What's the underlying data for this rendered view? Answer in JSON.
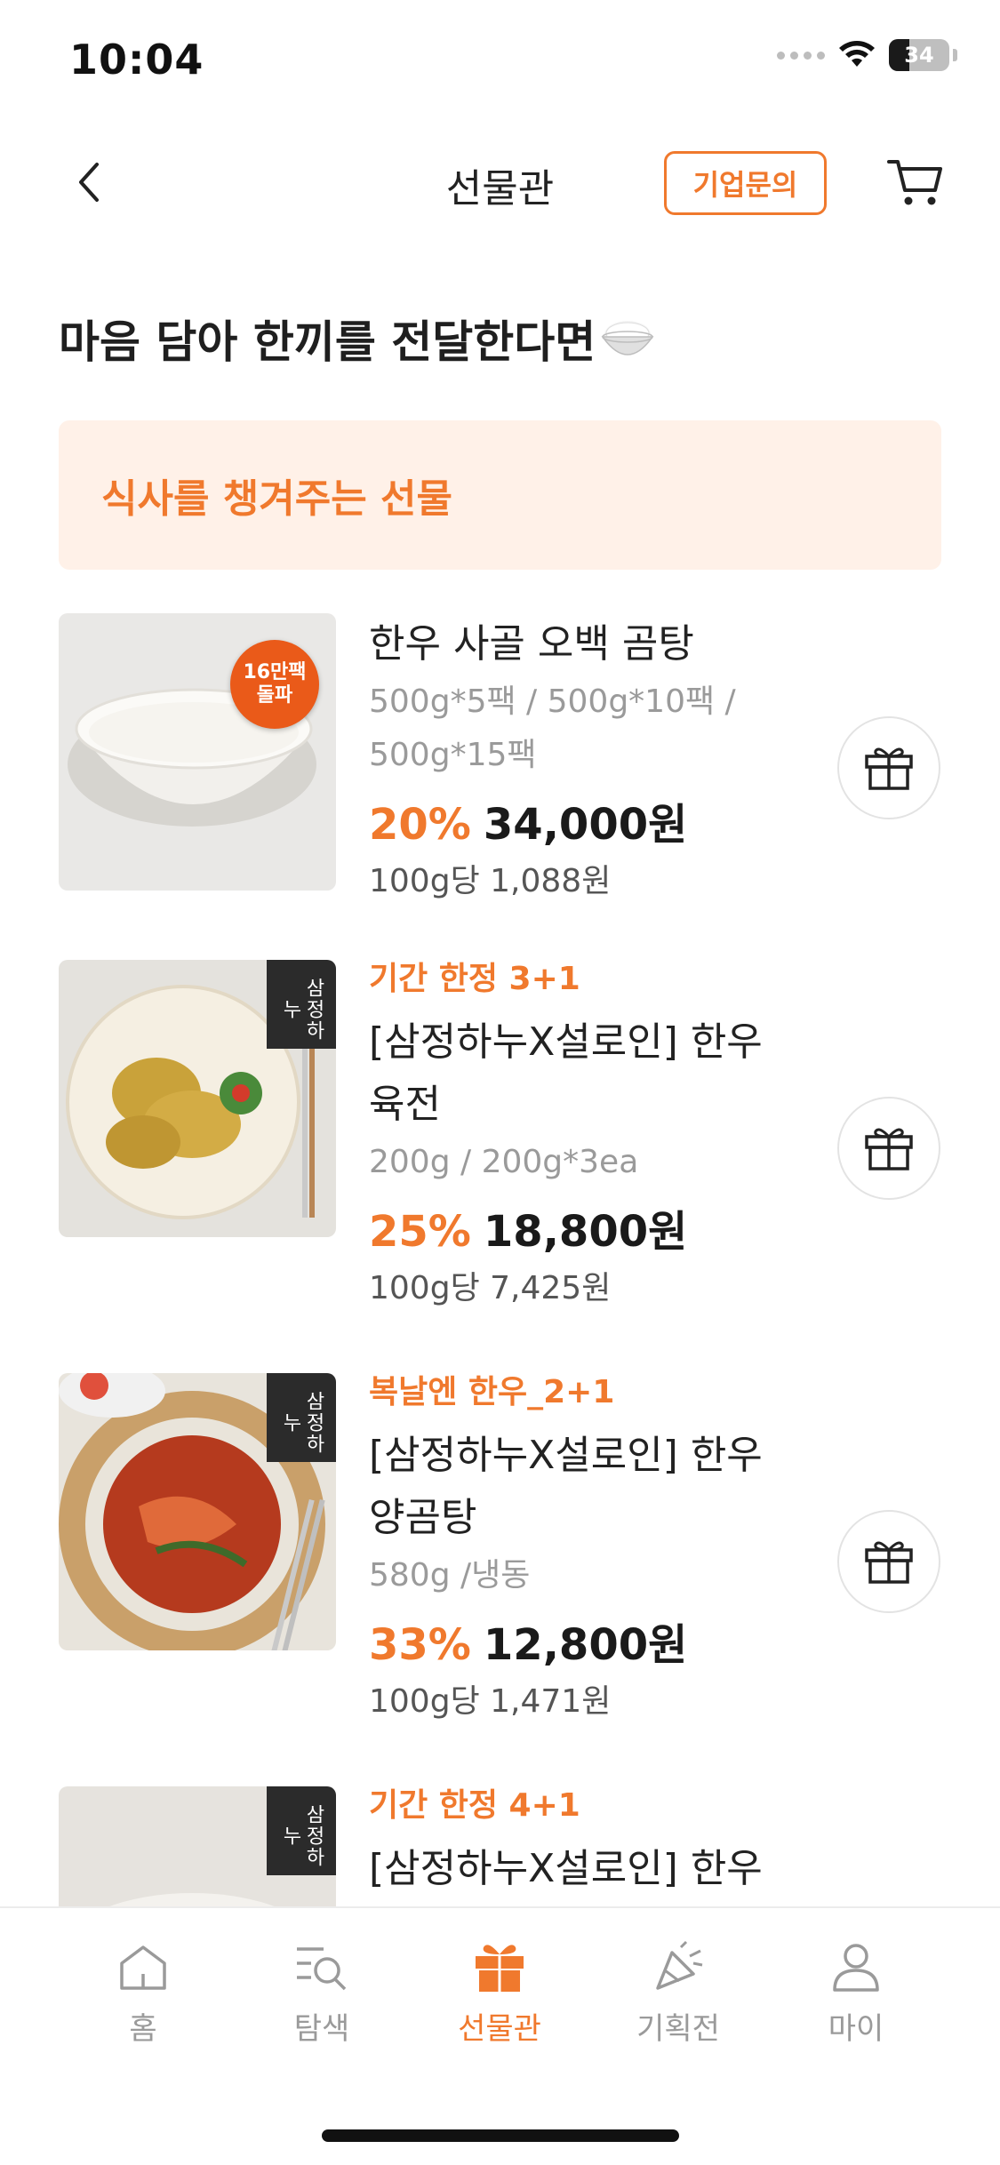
{
  "status_bar": {
    "time": "10:04",
    "battery": "34",
    "battery_level": 0.34
  },
  "nav": {
    "title": "선물관",
    "biz_button": "기업문의"
  },
  "heading": "마음 담아 한끼를 전달한다면",
  "banner": "식사를 챙겨주는 선물",
  "products": [
    {
      "badge_line1": "16만팩",
      "badge_line2": "돌파",
      "promo": "",
      "name_line1": "한우 사골 오백 곰탕",
      "name_line2": "",
      "options_line1": "500g*5팩 / 500g*10팩 /",
      "options_line2": "500g*15팩",
      "discount": "20%",
      "price": "34,000원",
      "unit_price": "100g당 1,088원"
    },
    {
      "brand_tag": "삼정하누",
      "promo": "기간 한정 3+1",
      "name_line1": "[삼정하누X설로인] 한우",
      "name_line2": "육전",
      "options_line1": "200g / 200g*3ea",
      "discount": "25%",
      "price": "18,800원",
      "unit_price": "100g당 7,425원"
    },
    {
      "brand_tag": "삼정하누",
      "promo": "복날엔 한우_2+1",
      "name_line1": "[삼정하누X설로인] 한우",
      "name_line2": "양곰탕",
      "options_line1": "580g /냉동",
      "discount": "33%",
      "price": "12,800원",
      "unit_price": "100g당 1,471원"
    },
    {
      "brand_tag": "삼정하누",
      "promo": "기간 한정 4+1",
      "name_line1": "[삼정하누X설로인] 한우"
    }
  ],
  "tabs": [
    {
      "label": "홈",
      "icon": "home-icon"
    },
    {
      "label": "탐색",
      "icon": "search-list-icon"
    },
    {
      "label": "선물관",
      "icon": "gift-icon",
      "active": true
    },
    {
      "label": "기획전",
      "icon": "party-icon"
    },
    {
      "label": "마이",
      "icon": "person-icon"
    }
  ],
  "colors": {
    "accent": "#f0792d",
    "banner_bg": "#fff1e8",
    "muted": "#9a9a9a"
  }
}
